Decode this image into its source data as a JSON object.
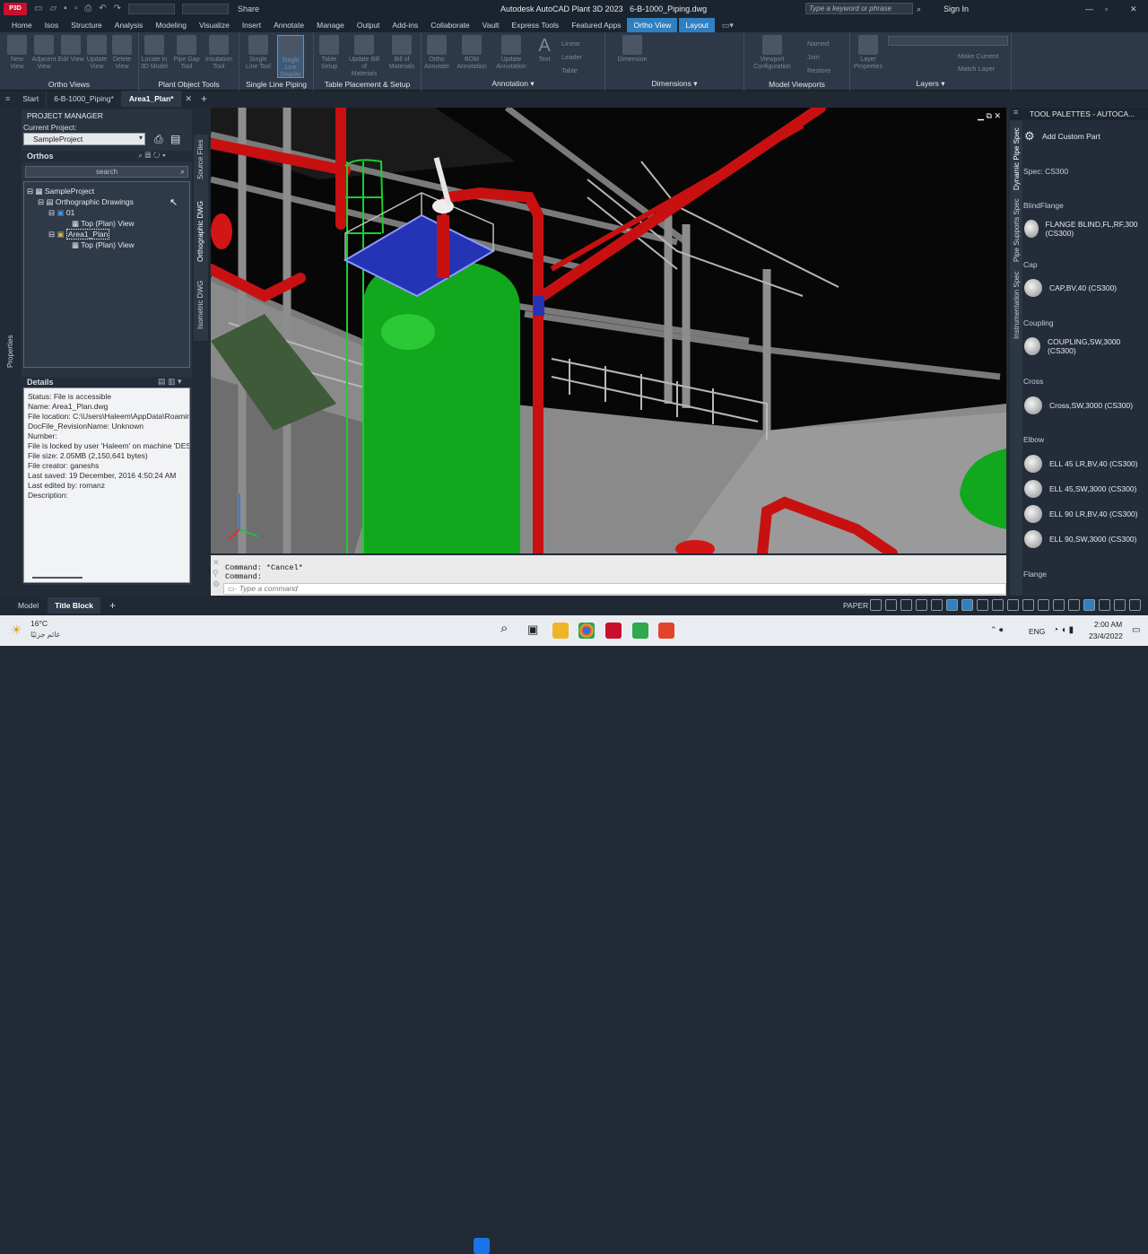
{
  "titlebar": {
    "app_badge": "P3D",
    "share": "Share",
    "title": "Autodesk AutoCAD Plant 3D 2023",
    "filename": "6-B-1000_Piping.dwg",
    "search_placeholder": "Type a keyword or phrase",
    "sign_in": "Sign In"
  },
  "menu": [
    "Home",
    "Isos",
    "Structure",
    "Analysis",
    "Modeling",
    "Visualize",
    "Insert",
    "Annotate",
    "Manage",
    "Output",
    "Add-ins",
    "Collaborate",
    "Vault",
    "Express Tools",
    "Featured Apps",
    "Ortho View",
    "Layout"
  ],
  "ribbon": {
    "groups": [
      {
        "label": "Ortho Views",
        "buttons": [
          "New View",
          "Adjacent View",
          "Edit View",
          "Update View",
          "Delete View"
        ]
      },
      {
        "label": "Plant Object Tools",
        "buttons": [
          "Locate in 3D Model",
          "Pipe Gap Tool",
          "Insulation Tool"
        ]
      },
      {
        "label": "Single Line Piping",
        "buttons": [
          "Single Line Tool",
          "Single Line Display"
        ]
      },
      {
        "label": "Table Placement & Setup",
        "buttons": [
          "Table Setup",
          "Update Bill of Materials",
          "Bill of Materials"
        ]
      },
      {
        "label": "Annotation",
        "buttons": [
          "Ortho Annotate",
          "BOM Annotation",
          "Update Annotation",
          "Text",
          "Linear",
          "Leader",
          "Table"
        ]
      },
      {
        "label": "Dimensions",
        "buttons": [
          "Dimension"
        ]
      },
      {
        "label": "Model Viewports",
        "buttons": [
          "Viewport Configuration",
          "Named",
          "Join",
          "Restore"
        ]
      },
      {
        "label": "Layers",
        "buttons": [
          "Layer Properties",
          "Make Current",
          "Match Layer"
        ]
      }
    ]
  },
  "doctabs": [
    "Start",
    "6-B-1000_Piping*",
    "Area1_Plan*"
  ],
  "project_manager": {
    "title": "PROJECT MANAGER",
    "current_project_label": "Current Project:",
    "current_project": "SampleProject",
    "orthos_label": "Orthos",
    "search_placeholder": "search",
    "tree": [
      "SampleProject",
      "Orthographic Drawings",
      "01",
      "Top (Plan) View",
      "Area1_Plan",
      "Top (Plan) View"
    ],
    "side_tabs": [
      "Source Files",
      "Orthographic DWG",
      "Isometric DWG"
    ],
    "details_label": "Details",
    "details": [
      "Status: File is accessible",
      "Name: Area1_Plan.dwg",
      "File location: C:\\Users\\Haleem\\AppData\\Roaming\\",
      "DocFile_RevisionName: Unknown",
      "Number:",
      "File is locked by user 'Haleem' on machine 'DESK",
      "File size: 2.05MB (2,150,641 bytes)",
      "File creator: ganeshs",
      "Last saved: 19 December, 2016 4:50:24 AM",
      "Last edited by: romanz",
      "Description:"
    ]
  },
  "properties_tab": "Properties",
  "command": {
    "line1": "Command: *Cancel*",
    "line2": "Command:",
    "placeholder": "Type a command"
  },
  "tool_palettes": {
    "title": "TOOL PALETTES - AUTOCA...",
    "side_tabs": [
      "Dynamic Pipe Spec",
      "Pipe Supports Spec",
      "Instrumentation Spec"
    ],
    "add_custom": "Add Custom Part",
    "spec": "Spec: CS300",
    "sections": [
      {
        "heading": "BlindFlange",
        "items": [
          "FLANGE BLIND,FL,RF,300 (CS300)"
        ]
      },
      {
        "heading": "Cap",
        "items": [
          "CAP,BV,40 (CS300)"
        ]
      },
      {
        "heading": "Coupling",
        "items": [
          "COUPLING,SW,3000 (CS300)"
        ]
      },
      {
        "heading": "Cross",
        "items": [
          "Cross,SW,3000 (CS300)"
        ]
      },
      {
        "heading": "Elbow",
        "items": [
          "ELL 45 LR,BV,40 (CS300)",
          "ELL 45,SW,3000 (CS300)",
          "ELL 90 LR,BV,40 (CS300)",
          "ELL 90,SW,3000 (CS300)"
        ]
      },
      {
        "heading": "Flange",
        "items": []
      }
    ]
  },
  "layout_tabs": [
    "Model",
    "Title Block"
  ],
  "status": {
    "paper": "PAPER"
  },
  "taskbar": {
    "temp": "16°C",
    "weather": "غائم جزئيًا",
    "lang": "ENG",
    "time": "2:00 AM",
    "date": "23/4/2022"
  },
  "colors": {
    "accent": "#2f7fc1",
    "pipe_red": "#d01010",
    "vessel_green": "#12b21e",
    "platform_blue": "#2430b8"
  }
}
